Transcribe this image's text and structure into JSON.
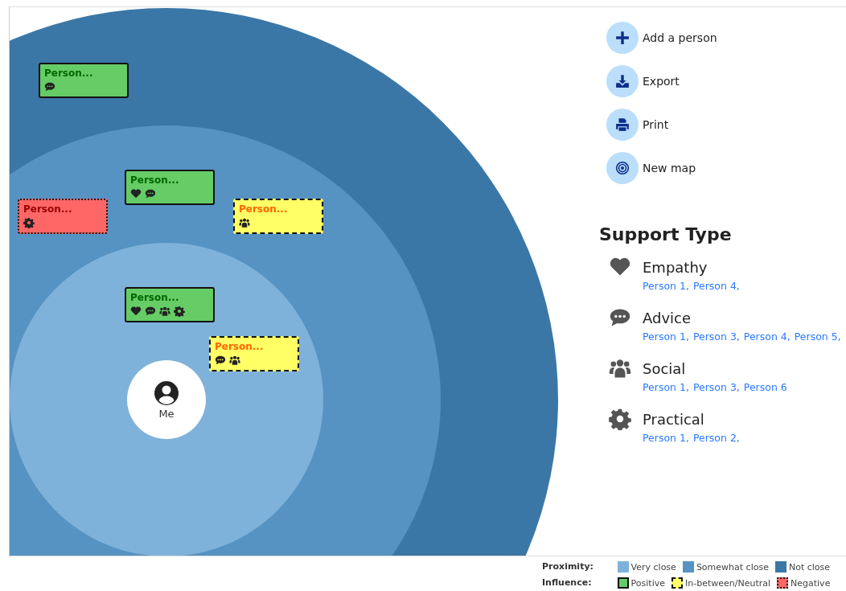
{
  "map": {
    "center_label": "Me",
    "people": [
      {
        "label": "Person...",
        "kind": "positive",
        "support": [
          {
            "kind": "advice"
          }
        ]
      },
      {
        "label": "Person...",
        "kind": "positive",
        "support": [
          {
            "kind": "empathy"
          },
          {
            "kind": "advice"
          }
        ]
      },
      {
        "label": "Person...",
        "kind": "negative",
        "support": [
          {
            "kind": "practical"
          }
        ]
      },
      {
        "label": "Person...",
        "kind": "neutral",
        "support": [
          {
            "kind": "social"
          }
        ]
      },
      {
        "label": "Person...",
        "kind": "positive",
        "support": [
          {
            "kind": "empathy"
          },
          {
            "kind": "advice"
          },
          {
            "kind": "social"
          },
          {
            "kind": "practical"
          }
        ]
      },
      {
        "label": "Person...",
        "kind": "neutral",
        "support": [
          {
            "kind": "advice"
          },
          {
            "kind": "social"
          }
        ]
      }
    ]
  },
  "actions": [
    {
      "kind": "add",
      "label": "Add a person"
    },
    {
      "kind": "export",
      "label": "Export"
    },
    {
      "kind": "print",
      "label": "Print"
    },
    {
      "kind": "new",
      "label": "New map"
    }
  ],
  "support_types": {
    "title": "Support Type",
    "items": [
      {
        "kind": "empathy",
        "name": "Empathy",
        "people": [
          "Person 1,",
          "Person 4,"
        ]
      },
      {
        "kind": "advice",
        "name": "Advice",
        "people": [
          "Person 1,",
          "Person 3,",
          "Person 4,",
          "Person 5,"
        ]
      },
      {
        "kind": "social",
        "name": "Social",
        "people": [
          "Person 1,",
          "Person 3,",
          "Person 6"
        ]
      },
      {
        "kind": "practical",
        "name": "Practical",
        "people": [
          "Person 1,",
          "Person 2,"
        ]
      }
    ]
  },
  "legend": {
    "proximity_label": "Proximity:",
    "proximity": [
      {
        "label": "Very close",
        "color": "#7fb2da"
      },
      {
        "label": "Somewhat close",
        "color": "#5693c2"
      },
      {
        "label": "Not close",
        "color": "#3b77a6"
      }
    ],
    "influence_label": "Influence:",
    "influence": [
      {
        "kind": "positive",
        "label": "Positive"
      },
      {
        "kind": "neutral",
        "label": "In-between/Neutral"
      },
      {
        "kind": "negative",
        "label": "Negative"
      }
    ]
  }
}
